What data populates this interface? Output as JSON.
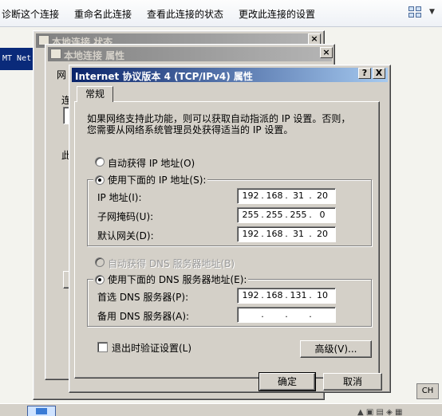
{
  "toolbar": {
    "diagnose": "诊断这个连接",
    "rename": "重命名此连接",
    "status": "查看此连接的状态",
    "change": "更改此连接的设置"
  },
  "desktop": {
    "net_label": "MT Net"
  },
  "status_window": {
    "title": "本地连接 状态"
  },
  "props_window": {
    "title": "本地连接 属性",
    "frag1": "网",
    "frag2": "连",
    "frag3": "此"
  },
  "dialog": {
    "title": "Internet 协议版本 4 (TCP/IPv4) 属性",
    "help": "?",
    "close": "X",
    "tab": "常规",
    "description_line1": "如果网络支持此功能，则可以获取自动指派的 IP 设置。否则，",
    "description_line2": "您需要从网络系统管理员处获得适当的 IP 设置。",
    "ip_auto": "自动获得 IP 地址(O)",
    "ip_manual": "使用下面的 IP 地址(S):",
    "ip_label": "IP 地址(I):",
    "mask_label": "子网掩码(U):",
    "gateway_label": "默认网关(D):",
    "ip": [
      "192",
      "168",
      "31",
      "20"
    ],
    "mask": [
      "255",
      "255",
      "255",
      "0"
    ],
    "gateway": [
      "192",
      "168",
      "31",
      "20"
    ],
    "dns_auto": "自动获得 DNS 服务器地址(B)",
    "dns_manual": "使用下面的 DNS 服务器地址(E):",
    "dns1_label": "首选 DNS 服务器(P):",
    "dns2_label": "备用 DNS 服务器(A):",
    "dns1": [
      "192",
      "168",
      "131",
      "10"
    ],
    "dns2": [
      "",
      "",
      "",
      ""
    ],
    "validate": "退出时验证设置(L)",
    "advanced": "高级(V)...",
    "ok": "确定",
    "cancel": "取消"
  },
  "taskbar": {
    "ime": "CH"
  }
}
